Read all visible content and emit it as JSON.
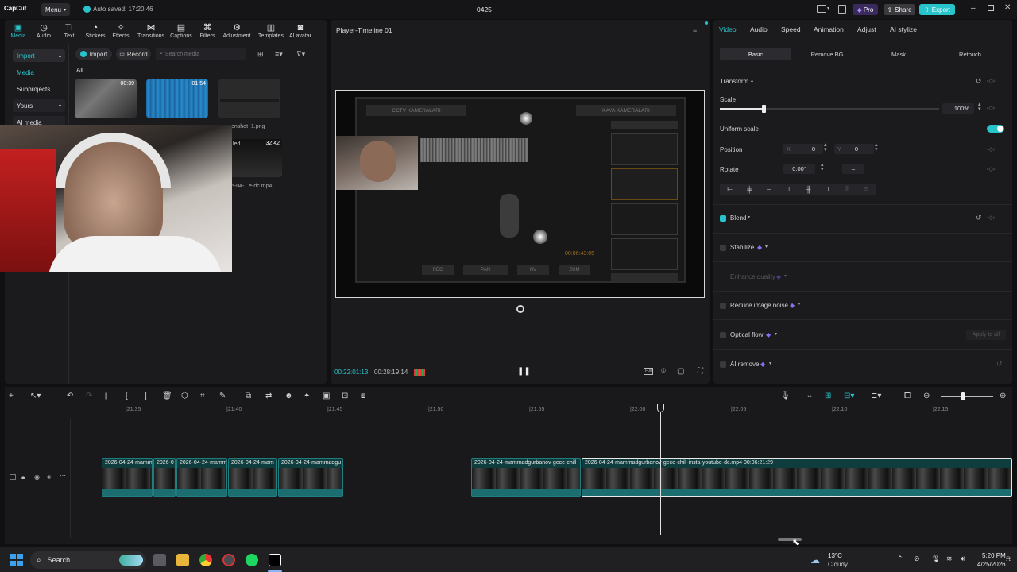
{
  "titlebar": {
    "logo": "CapCut",
    "menu_label": "Menu",
    "autosave": "Auto saved: 17:20:46",
    "project_title": "0425",
    "pro_label": "Pro",
    "share_label": "Share",
    "export_label": "Export"
  },
  "toolbar": {
    "items": [
      {
        "label": "Media",
        "icon": "media-icon"
      },
      {
        "label": "Audio",
        "icon": "audio-icon"
      },
      {
        "label": "Text",
        "icon": "text-icon"
      },
      {
        "label": "Stickers",
        "icon": "stickers-icon"
      },
      {
        "label": "Effects",
        "icon": "effects-icon"
      },
      {
        "label": "Transitions",
        "icon": "transitions-icon"
      },
      {
        "label": "Captions",
        "icon": "captions-icon"
      },
      {
        "label": "Filters",
        "icon": "filters-icon"
      },
      {
        "label": "Adjustment",
        "icon": "adjustment-icon"
      },
      {
        "label": "Templates",
        "icon": "templates-icon"
      },
      {
        "label": "AI avatar",
        "icon": "ai-avatar-icon"
      }
    ]
  },
  "media_sidebar": {
    "items": [
      "Import",
      "Media",
      "Subprojects",
      "Yours",
      "AI media"
    ]
  },
  "media_header": {
    "import_label": "Import",
    "record_label": "Record",
    "search_placeholder": "Search media",
    "filter_all": "All"
  },
  "media_items": [
    {
      "duration": "00:39",
      "name": ""
    },
    {
      "duration": "01:54",
      "name": ""
    },
    {
      "duration": "",
      "name": "enshot_1.png"
    },
    {
      "duration": "32:42",
      "name": "5-04-...e-dc.mp4",
      "overlay": "led"
    }
  ],
  "player": {
    "title": "Player-Timeline 01",
    "current_time": "00:22:01:13",
    "total_time": "00:28:19:14",
    "screen": {
      "left_header": "CCTV KAMERALARI",
      "right_header": "KAYA KAMERALARI",
      "timestamp": "00:06:43:05",
      "buttons": [
        "REC",
        "PAN",
        "NV",
        "ZUM"
      ]
    }
  },
  "details": {
    "tabs": [
      "Video",
      "Audio",
      "Speed",
      "Animation",
      "Adjust",
      "AI stylize"
    ],
    "subtabs": [
      "Basic",
      "Remove BG",
      "Mask",
      "Retouch"
    ],
    "transform_label": "Transform",
    "scale_label": "Scale",
    "scale_value": "100%",
    "scale_fraction": 0.2,
    "uniform_scale_label": "Uniform scale",
    "position_label": "Position",
    "pos_x_label": "X",
    "pos_x": "0",
    "pos_y_label": "Y",
    "pos_y": "0",
    "rotate_label": "Rotate",
    "rotate_value": "0.00°",
    "blend_label": "Blend",
    "stabilize_label": "Stabilize",
    "enhance_label": "Enhance quality",
    "noise_label": "Reduce image noise",
    "optical_label": "Optical flow",
    "apply_all_label": "Apply to all",
    "ai_remove_label": "AI remove"
  },
  "timeline": {
    "ruler": [
      "|21:35",
      "|21:40",
      "|21:45",
      "|21:50",
      "|21:55",
      "|22:00",
      "|22:05",
      "|22:10",
      "|22:15"
    ],
    "clips": [
      {
        "label": "2026-04-24-mamm"
      },
      {
        "label": "2026-0"
      },
      {
        "label": "2026-04-24-mamm"
      },
      {
        "label": "2026-04-24-mam"
      },
      {
        "label": "2026-04-24-mammadgu"
      },
      {
        "label": "2026-04-24-mammadgurbanov-gece-chill"
      },
      {
        "label": "2026-04-24-mammadgurbanov-gece-chill-insta-youtube-dc.mp4   00:06:21:29"
      }
    ]
  },
  "taskbar": {
    "search_label": "Search",
    "weather_temp": "13°C",
    "weather_desc": "Cloudy",
    "time": "5:20 PM",
    "date": "4/25/2026"
  },
  "colors": {
    "accent": "#27c4cc",
    "pro": "#7b4ce0",
    "clip": "#0f3d3e"
  }
}
